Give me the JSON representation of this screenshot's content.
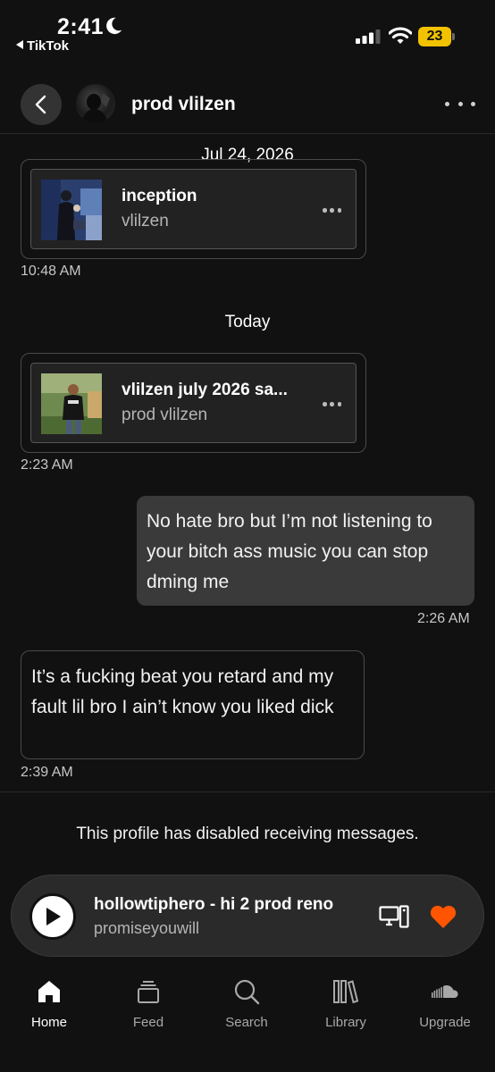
{
  "status_bar": {
    "time": "2:41",
    "back_app": "TikTok",
    "battery": "23"
  },
  "header": {
    "title": "prod vlilzen"
  },
  "messages": {
    "date1": "Jul 24, 2026",
    "card1": {
      "title": "inception",
      "artist": "vlilzen",
      "timestamp": "10:48 AM"
    },
    "date2": "Today",
    "card2": {
      "title": "vlilzen july 2026 sa...",
      "artist": "prod vlilzen",
      "timestamp": "2:23 AM"
    },
    "outgoing": {
      "text": "No hate bro but I’m not listening to your bitch ass music you can stop dming me",
      "timestamp": "2:26 AM"
    },
    "incoming": {
      "text": "It’s a fucking beat you retard and my fault lil bro I ain’t know you liked dick",
      "timestamp": "2:39 AM"
    },
    "disabled_notice": "This profile has disabled receiving messages."
  },
  "player": {
    "title": "hollowtiphero - hi 2 prod reno",
    "artist": "promiseyouwill",
    "accent_color": "#ff5500"
  },
  "tabs": [
    {
      "label": "Home",
      "icon": "home-icon",
      "active": true
    },
    {
      "label": "Feed",
      "icon": "feed-icon",
      "active": false
    },
    {
      "label": "Search",
      "icon": "search-icon",
      "active": false
    },
    {
      "label": "Library",
      "icon": "library-icon",
      "active": false
    },
    {
      "label": "Upgrade",
      "icon": "soundcloud-icon",
      "active": false
    }
  ]
}
